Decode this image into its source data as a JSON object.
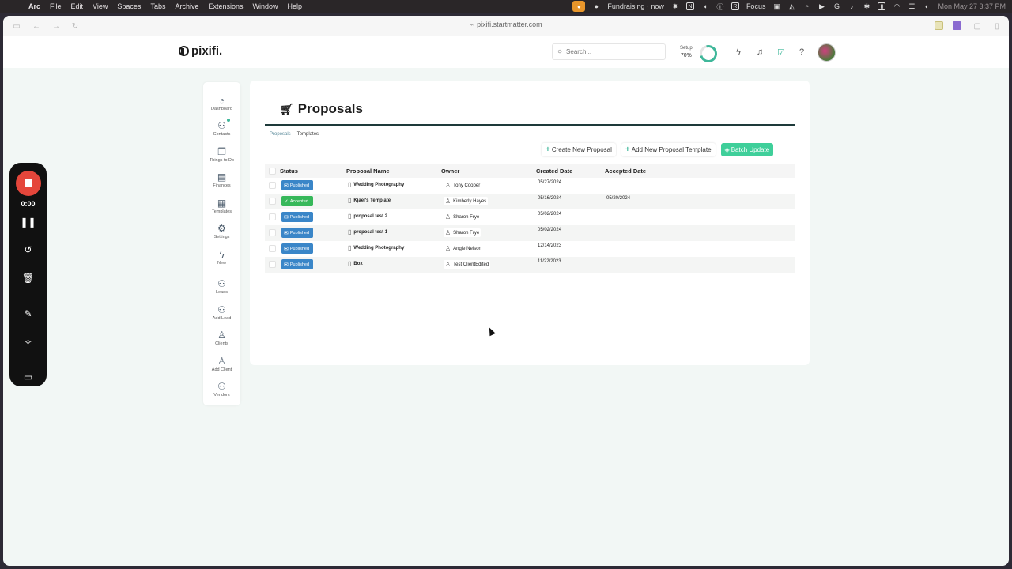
{
  "menubar": {
    "apple_icon": "apple-icon",
    "items": [
      "Arc",
      "File",
      "Edit",
      "View",
      "Spaces",
      "Tabs",
      "Archive",
      "Extensions",
      "Window",
      "Help"
    ],
    "status_text": "Fundraising · now",
    "focus_label": "Focus",
    "datetime": "Mon May 27  3:37 PM"
  },
  "browser": {
    "url": "pixifi.startmatter.com"
  },
  "header": {
    "logo": "pixifi.",
    "search_placeholder": "Search...",
    "setup_label": "Setup",
    "setup_percent": "70%",
    "setup_progress": 0.7,
    "accent_color": "#3fb79a"
  },
  "sidebar": {
    "items": [
      {
        "label": "Dashboard",
        "icon": "gauge-icon"
      },
      {
        "label": "Contacts",
        "icon": "contacts-icon"
      },
      {
        "label": "Things to Do",
        "icon": "checklist-icon"
      },
      {
        "label": "Finances",
        "icon": "chart-icon"
      },
      {
        "label": "Templates",
        "icon": "templates-icon"
      },
      {
        "label": "Settings",
        "icon": "gear-icon"
      },
      {
        "label": "New",
        "icon": "lightning-icon"
      },
      {
        "label": "Leads",
        "icon": "leads-icon"
      },
      {
        "label": "Add Lead",
        "icon": "add-lead-icon"
      },
      {
        "label": "Clients",
        "icon": "user-icon"
      },
      {
        "label": "Add Client",
        "icon": "add-user-icon"
      },
      {
        "label": "Vendors",
        "icon": "vendors-icon"
      }
    ]
  },
  "page": {
    "title": "Proposals",
    "breadcrumbs": [
      "Proposals",
      "Templates"
    ],
    "actions": {
      "create": "Create New Proposal",
      "add_template": "Add New Proposal Template",
      "batch": "Batch Update"
    }
  },
  "table": {
    "columns": [
      "Status",
      "Proposal Name",
      "Owner",
      "Created Date",
      "Accepted Date"
    ],
    "rows": [
      {
        "status": "Published",
        "name": "Wedding Photography",
        "owner": "Tony Cooper",
        "created": "05/27/2024",
        "accepted": ""
      },
      {
        "status": "Accepted",
        "name": "Kjael's Template",
        "owner": "Kimberly Hayes",
        "created": "05/16/2024",
        "accepted": "05/20/2024"
      },
      {
        "status": "Published",
        "name": "proposal test 2",
        "owner": "Sharon Frye",
        "created": "05/02/2024",
        "accepted": ""
      },
      {
        "status": "Published",
        "name": "proposal test 1",
        "owner": "Sharon Frye",
        "created": "05/02/2024",
        "accepted": ""
      },
      {
        "status": "Published",
        "name": "Wedding Photography",
        "owner": "Angie Nelson",
        "created": "12/14/2023",
        "accepted": ""
      },
      {
        "status": "Published",
        "name": "Box",
        "owner": "Test ClientEdited",
        "created": "11/22/2023",
        "accepted": ""
      }
    ]
  },
  "recorder": {
    "time": "0:00"
  }
}
